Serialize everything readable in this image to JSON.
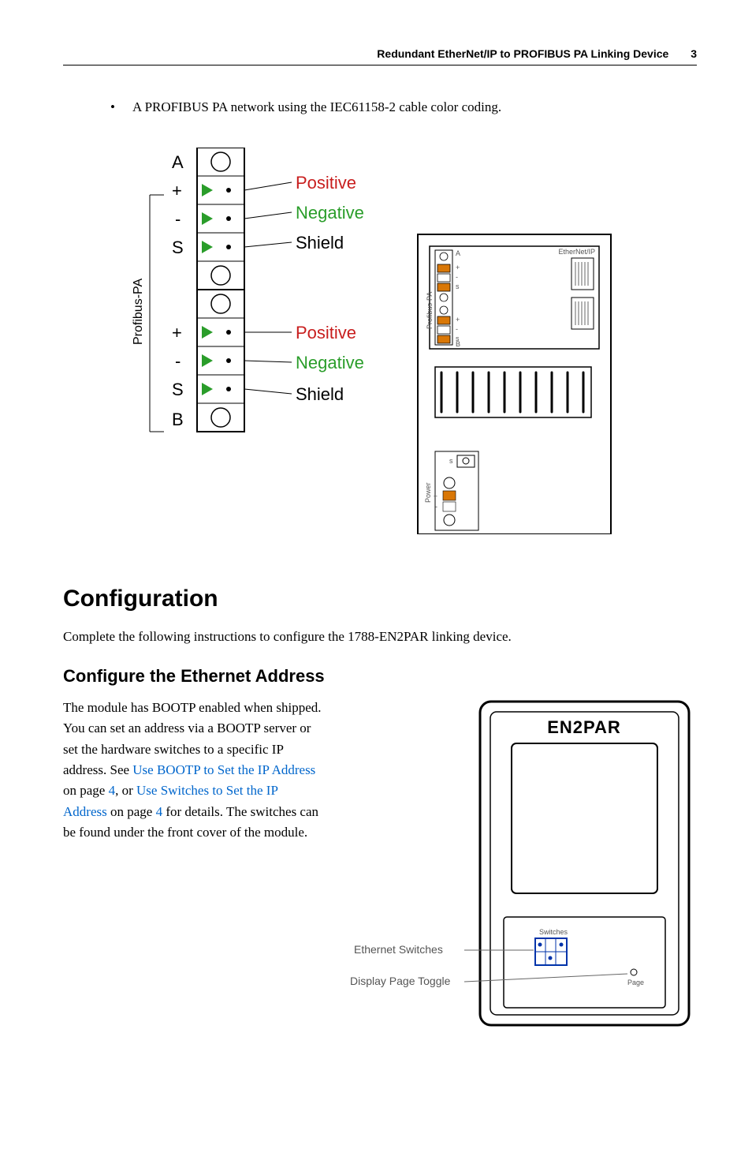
{
  "header": {
    "title": "Redundant EtherNet/IP to PROFIBUS PA Linking Device",
    "page": "3"
  },
  "bullet": {
    "text": "A PROFIBUS PA network using the IEC61158-2 cable color coding."
  },
  "wiring": {
    "sideLabel": "Profibus-PA",
    "blockA": {
      "letter": "A",
      "plus": "+",
      "minus": "-",
      "s": "S"
    },
    "blockB": {
      "letter": "B",
      "plus": "+",
      "minus": "-",
      "s": "S"
    },
    "labels": {
      "positive": "Positive",
      "negative": "Negative",
      "shield": "Shield"
    },
    "module": {
      "ethLabel": "EtherNet/IP",
      "paSide": "Profibus-PA",
      "powerSide": "Power",
      "a": "A",
      "b": "B",
      "s": "s",
      "plus": "+",
      "minus": "-"
    }
  },
  "section": {
    "title": "Configuration",
    "intro": "Complete the following instructions to configure the 1788-EN2PAR linking device."
  },
  "subsection": {
    "title": "Configure the Ethernet Address",
    "p1a": "The module has BOOTP enabled when shipped. You can set an address via a BOOTP server or set the hardware switches to a specific IP address. See ",
    "link1": "Use BOOTP to Set the IP Address",
    "p1b": " on page ",
    "pageRef1": "4",
    "p1c": ", or ",
    "link2": "Use Switches to Set the IP Address",
    "p1d": " on page ",
    "pageRef2": "4",
    "p1e": " for details. The switches can be found under the front cover of the module."
  },
  "deviceFig": {
    "title": "EN2PAR",
    "callout1": "Ethernet Switches",
    "callout2": "Display Page Toggle",
    "switches": "Switches",
    "page": "Page"
  }
}
